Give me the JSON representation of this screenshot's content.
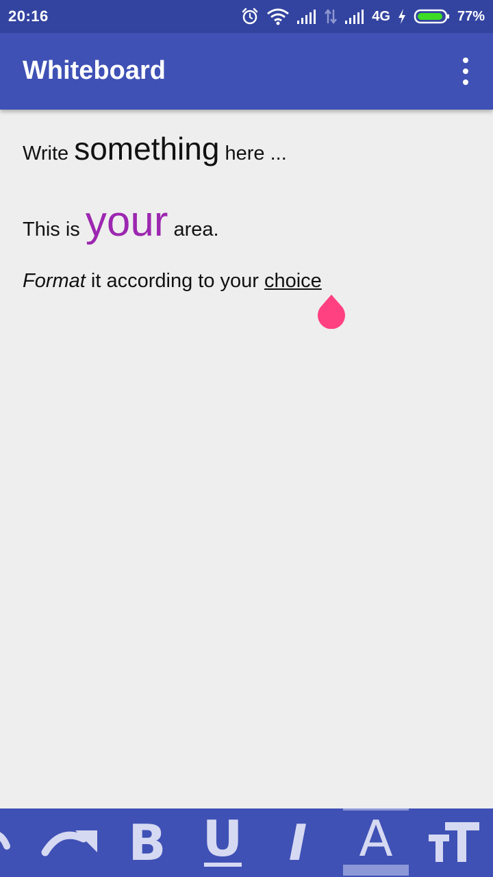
{
  "status_bar": {
    "time": "20:16",
    "network": "4G",
    "battery": "77%",
    "icons": [
      "alarm-icon",
      "wifi-icon",
      "signal-icon",
      "data-transfer-icon",
      "signal-icon",
      "charging-icon",
      "battery-icon"
    ]
  },
  "app_bar": {
    "title": "Whiteboard",
    "menu_icon": "overflow-menu-icon"
  },
  "editor": {
    "line1": {
      "pre": "Write ",
      "big": "something",
      "post": " here ..."
    },
    "line2": {
      "pre": "This is ",
      "huge": "your",
      "post": " area."
    },
    "line3": {
      "italic": "Format",
      "middle": " it according to your ",
      "underlined": "choice"
    },
    "colors": {
      "highlight": "#9C27B0",
      "cursor_handle": "#FF4081"
    }
  },
  "toolbar": {
    "undo_icon": "undo-icon",
    "redo_icon": "redo-icon",
    "bold_label": "B",
    "underline_label": "U",
    "italic_label": "I",
    "text_color_label": "A",
    "text_size_icon": "text-size-icon",
    "colors": {
      "background": "#3F51B5",
      "icon": "#D6D9F2",
      "active": "#8C98D8"
    }
  }
}
